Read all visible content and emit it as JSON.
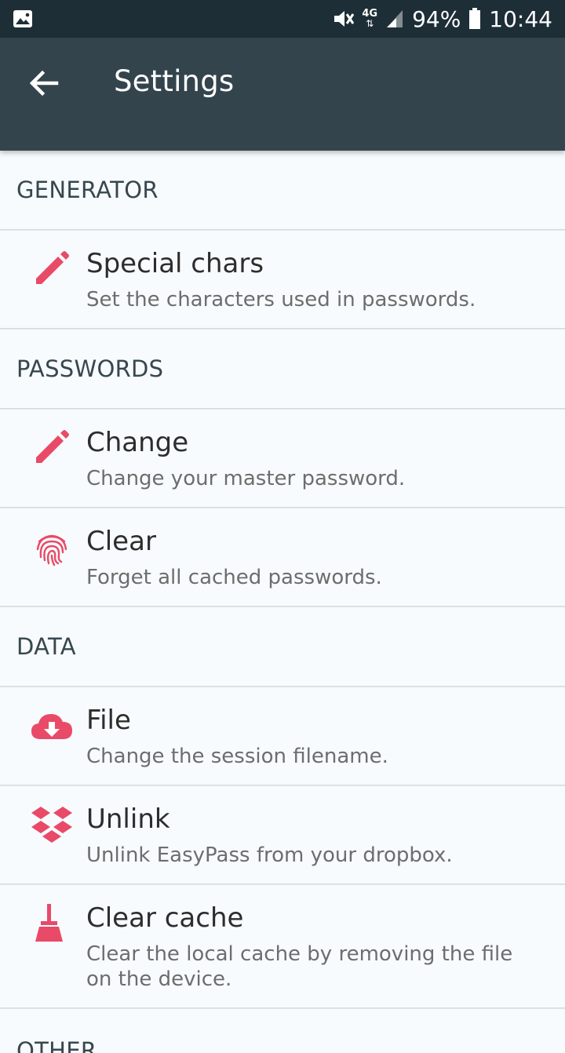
{
  "status_bar": {
    "network": "4G",
    "battery": "94%",
    "time": "10:44"
  },
  "app_bar": {
    "title": "Settings"
  },
  "sections": [
    {
      "header": "GENERATOR",
      "items": [
        {
          "icon": "pencil-icon",
          "title": "Special chars",
          "summary": "Set the characters used in passwords."
        }
      ]
    },
    {
      "header": "PASSWORDS",
      "items": [
        {
          "icon": "pencil-icon",
          "title": "Change",
          "summary": "Change your master password."
        },
        {
          "icon": "fingerprint-icon",
          "title": "Clear",
          "summary": "Forget all cached passwords."
        }
      ]
    },
    {
      "header": "DATA",
      "items": [
        {
          "icon": "cloud-download-icon",
          "title": "File",
          "summary": "Change the session filename."
        },
        {
          "icon": "dropbox-icon",
          "title": "Unlink",
          "summary": "Unlink EasyPass from your dropbox."
        },
        {
          "icon": "broom-icon",
          "title": "Clear cache",
          "summary": "Clear the local cache by removing the file on the device."
        }
      ]
    },
    {
      "header": "OTHER"
    }
  ],
  "colors": {
    "accent": "#e94a68",
    "status_bar": "#1d2e37",
    "app_bar": "#34444d",
    "background": "#f7fbfd"
  }
}
